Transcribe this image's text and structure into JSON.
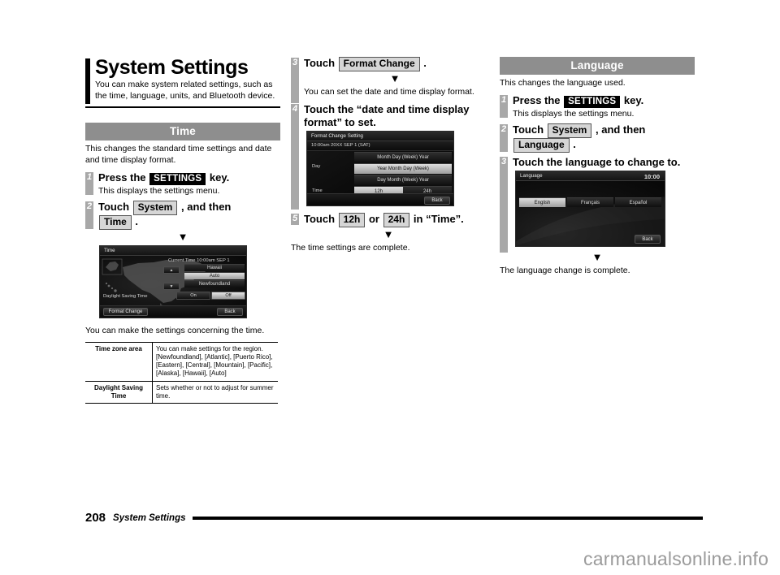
{
  "document": {
    "title": "System Settings",
    "intro": "You can make system related settings, such as the time, language, units, and Bluetooth device.",
    "footer_page_number": "208",
    "footer_title": "System Settings",
    "watermark": "carmanualsonline.info"
  },
  "time_section": {
    "band": "Time",
    "intro": "This changes the standard time settings and date and time display format.",
    "steps": [
      {
        "num": "1",
        "head_before": "Press the",
        "chip": "SETTINGS",
        "head_after": "key.",
        "sub": "This displays the settings menu."
      },
      {
        "num": "2",
        "head_before": "Touch",
        "chip1": "System",
        "head_mid": ", and then",
        "chip2": "Time",
        "head_after": "."
      }
    ],
    "arrow": "▼",
    "after_screen_text": "You can make the settings concerning the time.",
    "table": {
      "rows": [
        {
          "key": "Time zone area",
          "value": "You can make settings for the region.\n[Newfoundland], [Atlantic], [Puerto Rico], [Eastern], [Central], [Mountain], [Pacific], [Alaska], [Hawaii], [Auto]"
        },
        {
          "key": "Daylight Saving Time",
          "value": "Sets whether or not to adjust for summer time."
        }
      ]
    },
    "screen": {
      "header_title": "Time",
      "current_time_label": "Current Time 10:00am SEP  1",
      "zone_options": [
        "Hawaii",
        "Auto",
        "Newfoundland"
      ],
      "selected_zone": "Auto",
      "dst_label": "Daylight Saving Time",
      "dst_on": "On",
      "dst_off": "Off",
      "dst_selected": "Off",
      "format_change_button": "Format Change",
      "back_button": "Back",
      "up_arrow": "▲",
      "down_arrow": "▼"
    }
  },
  "format_section": {
    "steps": [
      {
        "num": "3",
        "head_before": "Touch",
        "chip": "Format Change",
        "head_after": "."
      },
      {
        "num": "4",
        "head": "Touch the “date and time display format” to set."
      },
      {
        "num": "5",
        "head_before": "Touch",
        "chip1": "12h",
        "head_mid": "or",
        "chip2": "24h",
        "head_after": "in “Time”."
      }
    ],
    "arrow": "▼",
    "after_step3_text": "You can set the date and time display format.",
    "complete_text": "The time settings are complete.",
    "screen": {
      "header_title": "Format Change Setting",
      "preview": "10:00am 20XX SEP  1 (SAT)",
      "day_label": "Day",
      "day_options": [
        "Month Day (Week) Year",
        "Year Month Day (Week)",
        "Day Month (Week) Year"
      ],
      "day_selected": "Year Month Day (Week)",
      "time_label": "Time",
      "time_options": [
        "12h",
        "24h"
      ],
      "time_selected": "12h",
      "back_button": "Back"
    }
  },
  "language_section": {
    "band": "Language",
    "intro": "This changes the language used.",
    "steps": [
      {
        "num": "1",
        "head_before": "Press the",
        "chip": "SETTINGS",
        "head_after": "key.",
        "sub": "This displays the settings menu."
      },
      {
        "num": "2",
        "head_before": "Touch",
        "chip1": "System",
        "head_mid": ", and then",
        "chip2": "Language",
        "head_after": "."
      },
      {
        "num": "3",
        "head": "Touch the language to change to."
      }
    ],
    "arrow": "▼",
    "complete_text": "The language change is complete.",
    "screen": {
      "header_title": "Language",
      "clock": "10:00",
      "options": [
        "English",
        "Français",
        "Español"
      ],
      "selected": "English",
      "back_button": "Back"
    }
  },
  "colors": {
    "band_gray": "#8e8e8e",
    "step_gray": "#a8a8a8",
    "chip_gray": "#d6d6d6",
    "watermark_gray": "#9b9b9b"
  }
}
